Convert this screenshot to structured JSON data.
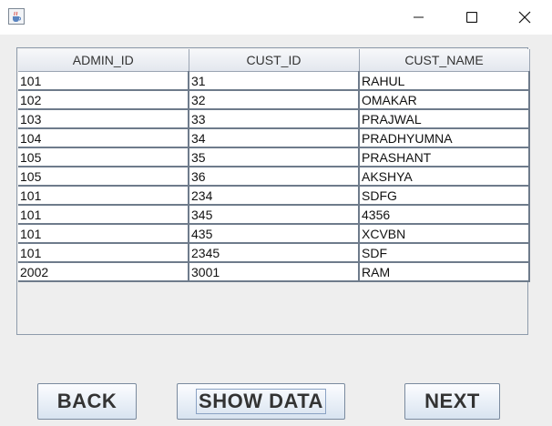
{
  "table": {
    "columns": [
      "ADMIN_ID",
      "CUST_ID",
      "CUST_NAME"
    ],
    "rows": [
      [
        "101",
        "31",
        "RAHUL"
      ],
      [
        "102",
        "32",
        "OMAKAR"
      ],
      [
        "103",
        "33",
        "PRAJWAL"
      ],
      [
        "104",
        "34",
        "PRADHYUMNA"
      ],
      [
        "105",
        "35",
        "PRASHANT"
      ],
      [
        "105",
        "36",
        "AKSHYA"
      ],
      [
        "101",
        "234",
        "SDFG"
      ],
      [
        "101",
        "345",
        "4356"
      ],
      [
        "101",
        "435",
        "XCVBN"
      ],
      [
        "101",
        "2345",
        "SDF"
      ],
      [
        "2002",
        "3001",
        "RAM"
      ]
    ]
  },
  "buttons": {
    "back": "BACK",
    "show_data": "SHOW DATA",
    "next": "NEXT"
  },
  "icons": {
    "app": "java-cup-icon",
    "minimize": "minimize-icon",
    "maximize": "maximize-icon",
    "close": "close-icon"
  }
}
